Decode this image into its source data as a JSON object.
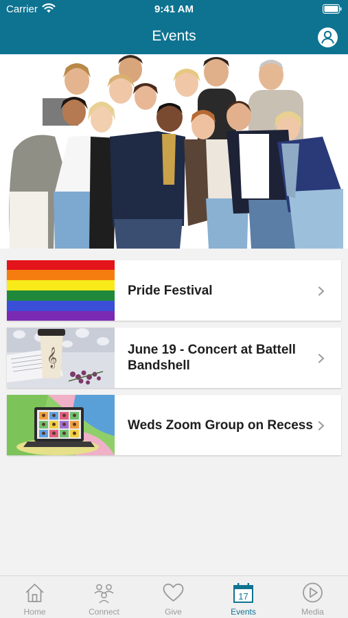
{
  "status_bar": {
    "carrier": "Carrier",
    "time": "9:41 AM"
  },
  "header": {
    "title": "Events"
  },
  "events": [
    {
      "title": "Pride Festival",
      "image": "rainbow-flag"
    },
    {
      "title": "June 19 - Concert at Battell Bandshell",
      "image": "coffee-cup-and-sheet-music"
    },
    {
      "title": "Weds Zoom Group on Recess",
      "image": "laptop-video-call"
    }
  ],
  "tabs": [
    {
      "label": "Home",
      "icon": "house-icon"
    },
    {
      "label": "Connect",
      "icon": "people-icon"
    },
    {
      "label": "Give",
      "icon": "heart-icon"
    },
    {
      "label": "Events",
      "icon": "calendar-icon",
      "badge": "17",
      "active": true
    },
    {
      "label": "Media",
      "icon": "play-icon"
    }
  ],
  "colors": {
    "brand": "#0e7391",
    "tab_inactive": "#9a9a9a",
    "background": "#f2f2f2"
  }
}
